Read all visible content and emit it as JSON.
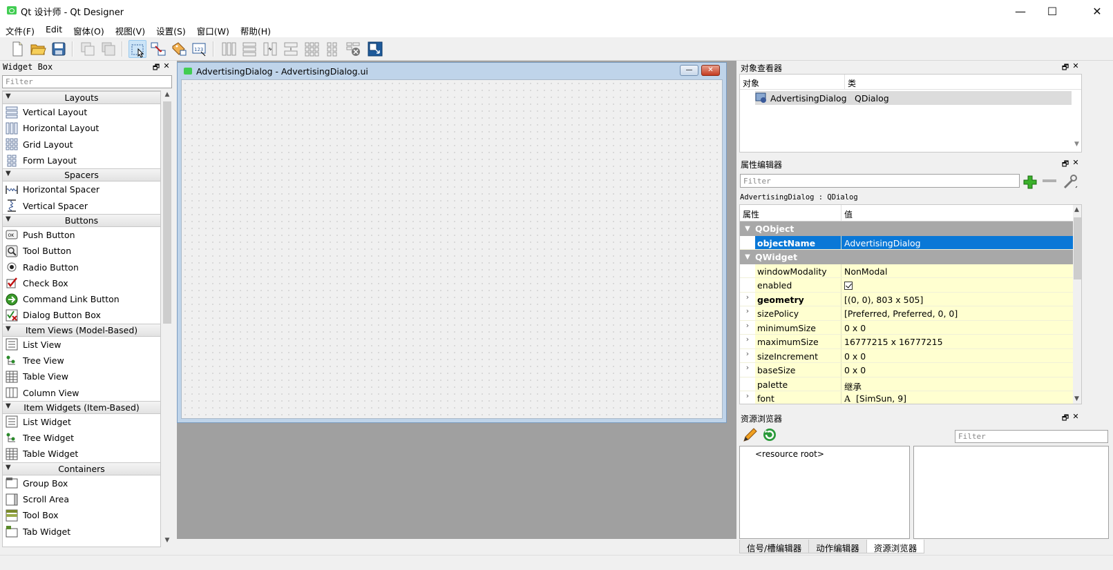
{
  "window": {
    "title": "Qt 设计师 - Qt Designer",
    "minimize_glyph": "—",
    "maximize_glyph": "☐",
    "close_glyph": "✕"
  },
  "menubar": {
    "items": [
      "文件(F)",
      "Edit",
      "窗体(O)",
      "视图(V)",
      "设置(S)",
      "窗口(W)",
      "帮助(H)"
    ]
  },
  "toolbar": {
    "icons": [
      "new-file-icon",
      "open-folder-icon",
      "save-icon",
      "cut-copy-disabled-icon",
      "paste-disabled-icon",
      "edit-widgets-icon",
      "edit-signals-slots-icon",
      "edit-buddies-icon",
      "edit-tab-order-icon",
      "layout-horizontal-icon",
      "layout-vertical-icon",
      "layout-splitter-h-icon",
      "layout-splitter-v-icon",
      "layout-grid-icon",
      "layout-form-icon",
      "break-layout-icon",
      "adjust-size-icon"
    ]
  },
  "widget_box": {
    "title": "Widget Box",
    "filter_placeholder": "Filter",
    "categories": [
      {
        "name": "Layouts",
        "items": [
          "Vertical Layout",
          "Horizontal Layout",
          "Grid Layout",
          "Form Layout"
        ]
      },
      {
        "name": "Spacers",
        "items": [
          "Horizontal Spacer",
          "Vertical Spacer"
        ]
      },
      {
        "name": "Buttons",
        "items": [
          "Push Button",
          "Tool Button",
          "Radio Button",
          "Check Box",
          "Command Link Button",
          "Dialog Button Box"
        ]
      },
      {
        "name": "Item Views (Model-Based)",
        "items": [
          "List View",
          "Tree View",
          "Table View",
          "Column View"
        ]
      },
      {
        "name": "Item Widgets (Item-Based)",
        "items": [
          "List Widget",
          "Tree Widget",
          "Table Widget"
        ]
      },
      {
        "name": "Containers",
        "items": [
          "Group Box",
          "Scroll Area",
          "Tool Box",
          "Tab Widget"
        ]
      }
    ]
  },
  "form_window": {
    "title": "AdvertisingDialog - AdvertisingDialog.ui"
  },
  "object_inspector": {
    "title": "对象查看器",
    "col_object": "对象",
    "col_class": "类",
    "row_object": "AdvertisingDialog",
    "row_class": "QDialog"
  },
  "property_editor": {
    "title": "属性编辑器",
    "filter_placeholder": "Filter",
    "context_label": "AdvertisingDialog : QDialog",
    "col_property": "属性",
    "col_value": "值",
    "groups": [
      {
        "name": "QObject",
        "rows": [
          {
            "name": "objectName",
            "value": "AdvertisingDialog",
            "expandable": false,
            "bold": true,
            "selected": true
          }
        ]
      },
      {
        "name": "QWidget",
        "rows": [
          {
            "name": "windowModality",
            "value": "NonModal",
            "expandable": false
          },
          {
            "name": "enabled",
            "value": "",
            "checkbox": true,
            "expandable": false
          },
          {
            "name": "geometry",
            "value": "[(0, 0), 803 x 505]",
            "expandable": true,
            "bold": true
          },
          {
            "name": "sizePolicy",
            "value": "[Preferred, Preferred, 0, 0]",
            "expandable": true
          },
          {
            "name": "minimumSize",
            "value": "0 x 0",
            "expandable": true
          },
          {
            "name": "maximumSize",
            "value": "16777215 x 16777215",
            "expandable": true
          },
          {
            "name": "sizeIncrement",
            "value": "0 x 0",
            "expandable": true
          },
          {
            "name": "baseSize",
            "value": "0 x 0",
            "expandable": true
          },
          {
            "name": "palette",
            "value": "继承",
            "expandable": false
          },
          {
            "name": "font",
            "value": "[SimSun, 9]",
            "font_icon": "A",
            "expandable": true
          }
        ]
      }
    ]
  },
  "resource_browser": {
    "title": "资源浏览器",
    "filter_placeholder": "Filter",
    "root_node": "<resource root>"
  },
  "bottom_tabs": {
    "items": [
      "信号/槽编辑器",
      "动作编辑器",
      "资源浏览器"
    ],
    "active": "资源浏览器"
  },
  "dock_buttons": {
    "float": "🗗",
    "close": "✕"
  },
  "colors": {
    "selection": "#0a78d7",
    "property_row_bg": "#ffffd0",
    "group_header_bg": "#a8a8a8",
    "mdi_background": "#a0a0a0"
  }
}
